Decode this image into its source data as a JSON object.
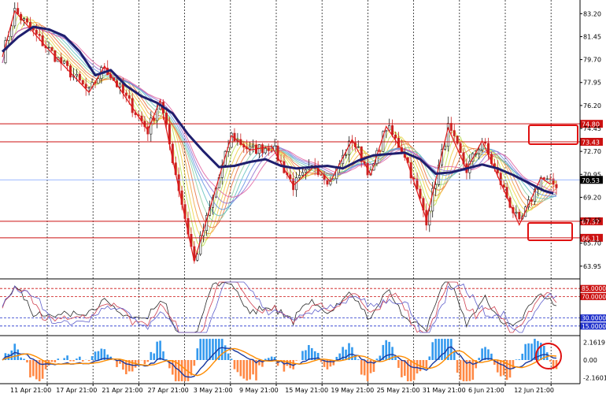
{
  "colors": {
    "grid": "#222222",
    "bull": "#1a1a1a",
    "bear": "#cc2222",
    "ma_thick": "#1f1f6e",
    "zigzag": "#e01818",
    "hline": "#cc1111",
    "price_line": "#7aa0ff",
    "hist_pos": "#3399ee",
    "hist_neg": "#ff8844",
    "osc1": "#2a2a2a",
    "osc2": "#d04050",
    "osc3": "#6060cc",
    "macd_main": "#1a3aa0",
    "macd_signal": "#ff8c00"
  },
  "chart_data": [
    {
      "type": "candlestick",
      "title": "",
      "price_axis_ticks": [
        "83.20",
        "81.45",
        "79.70",
        "77.95",
        "76.20",
        "74.45",
        "72.70",
        "70.95",
        "69.20",
        "67.45",
        "65.70",
        "63.95"
      ],
      "ylim": [
        63.1,
        84.0
      ],
      "x_tick_labels": [
        "11 Apr 21:00",
        "17 Apr 21:00",
        "21 Apr 21:00",
        "27 Apr 21:00",
        "3 May 21:00",
        "9 May 21:00",
        "15 May 21:00",
        "19 May 21:00",
        "25 May 21:00",
        "31 May 21:00",
        "6 Jun 21:00",
        "12 Jun 21:00"
      ],
      "horizontal_levels": [
        {
          "value": 74.8,
          "label": "74.80"
        },
        {
          "value": 73.43,
          "label": "73.43"
        },
        {
          "value": 67.37,
          "label": "67.37"
        },
        {
          "value": 66.11,
          "label": "66.11"
        }
      ],
      "current_price": {
        "value": 70.53,
        "label": "70.53"
      },
      "zigzag": [
        {
          "i": 0,
          "y": 79.9
        },
        {
          "i": 4,
          "y": 83.4
        },
        {
          "i": 14,
          "y": 80.7
        },
        {
          "i": 28,
          "y": 77.2
        },
        {
          "i": 33,
          "y": 79.2
        },
        {
          "i": 47,
          "y": 74.3
        },
        {
          "i": 51,
          "y": 76.6
        },
        {
          "i": 62,
          "y": 64.3
        },
        {
          "i": 74,
          "y": 73.9
        },
        {
          "i": 80,
          "y": 72.8
        },
        {
          "i": 87,
          "y": 73.1
        },
        {
          "i": 94,
          "y": 70.1
        },
        {
          "i": 101,
          "y": 71.6
        },
        {
          "i": 106,
          "y": 70.4
        },
        {
          "i": 113,
          "y": 73.6
        },
        {
          "i": 119,
          "y": 70.9
        },
        {
          "i": 124,
          "y": 74.6
        },
        {
          "i": 130,
          "y": 72.5
        },
        {
          "i": 137,
          "y": 67.5
        },
        {
          "i": 144,
          "y": 74.5
        },
        {
          "i": 150,
          "y": 71.3
        },
        {
          "i": 155,
          "y": 73.5
        },
        {
          "i": 167,
          "y": 67.1
        },
        {
          "i": 174,
          "y": 70.7
        },
        {
          "i": 177,
          "y": 70.2
        }
      ],
      "ma_thick": [
        {
          "i": 0,
          "y": 80.3
        },
        {
          "i": 5,
          "y": 81.4
        },
        {
          "i": 10,
          "y": 82.2
        },
        {
          "i": 15,
          "y": 82.0
        },
        {
          "i": 20,
          "y": 81.5
        },
        {
          "i": 25,
          "y": 80.3
        },
        {
          "i": 30,
          "y": 78.5
        },
        {
          "i": 35,
          "y": 78.9
        },
        {
          "i": 40,
          "y": 77.7
        },
        {
          "i": 45,
          "y": 76.9
        },
        {
          "i": 50,
          "y": 76.4
        },
        {
          "i": 55,
          "y": 75.6
        },
        {
          "i": 60,
          "y": 74.0
        },
        {
          "i": 65,
          "y": 72.7
        },
        {
          "i": 70,
          "y": 71.5
        },
        {
          "i": 75,
          "y": 71.6
        },
        {
          "i": 80,
          "y": 71.9
        },
        {
          "i": 85,
          "y": 72.1
        },
        {
          "i": 90,
          "y": 71.6
        },
        {
          "i": 95,
          "y": 71.4
        },
        {
          "i": 100,
          "y": 71.5
        },
        {
          "i": 105,
          "y": 71.6
        },
        {
          "i": 110,
          "y": 71.4
        },
        {
          "i": 115,
          "y": 72.0
        },
        {
          "i": 120,
          "y": 72.4
        },
        {
          "i": 125,
          "y": 72.5
        },
        {
          "i": 130,
          "y": 72.6
        },
        {
          "i": 135,
          "y": 72.1
        },
        {
          "i": 140,
          "y": 71.0
        },
        {
          "i": 145,
          "y": 71.1
        },
        {
          "i": 150,
          "y": 71.4
        },
        {
          "i": 155,
          "y": 71.7
        },
        {
          "i": 160,
          "y": 71.4
        },
        {
          "i": 165,
          "y": 70.9
        },
        {
          "i": 170,
          "y": 70.3
        },
        {
          "i": 175,
          "y": 69.7
        },
        {
          "i": 178,
          "y": 69.5
        }
      ],
      "candles_count": 180,
      "candle_series_seed": [
        79.9,
        83.4,
        80.7,
        77.2,
        79.2,
        74.3,
        76.6,
        64.3,
        73.9,
        70.1,
        73.6,
        70.4,
        74.6,
        67.5,
        74.5,
        71.3,
        73.5,
        67.1,
        70.7
      ]
    },
    {
      "type": "line",
      "name_visible": false,
      "ylim": [
        0,
        100
      ],
      "levels": [
        {
          "value": 85,
          "label": "85.0000"
        },
        {
          "value": 70,
          "label": "70.0000"
        },
        {
          "value": 30,
          "label": "30.0000"
        },
        {
          "value": 15,
          "label": "15.0000"
        }
      ],
      "series_count": 3
    },
    {
      "type": "bar",
      "ylim": [
        -2.8,
        2.8
      ],
      "axis_ticks": [
        "2.1619",
        "0.00",
        "-2.1601"
      ],
      "zero_label": "0.00"
    }
  ]
}
